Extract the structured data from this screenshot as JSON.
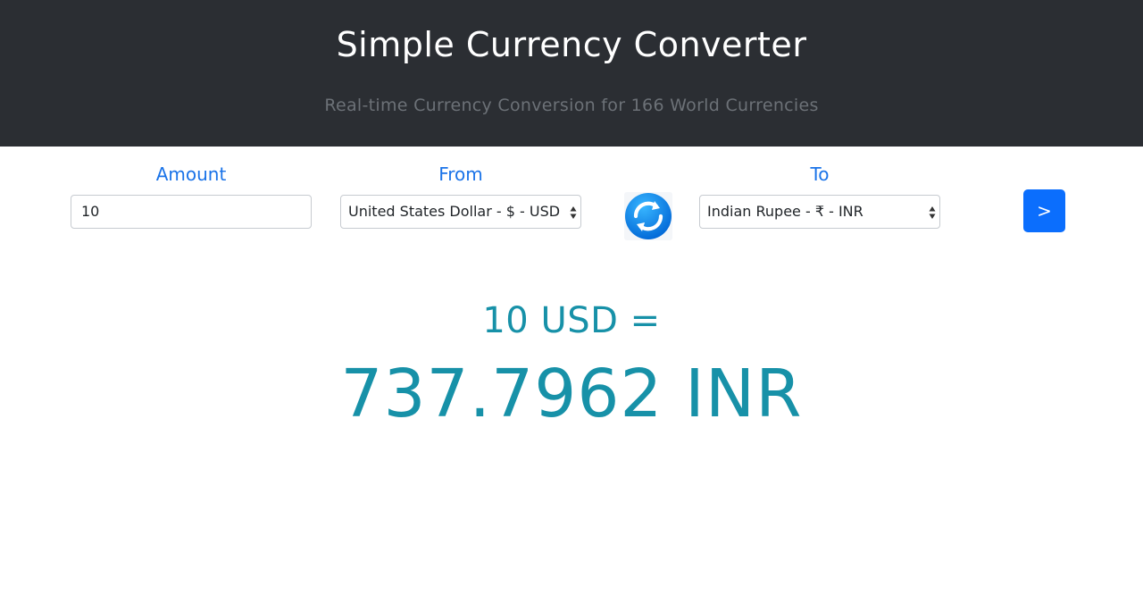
{
  "header": {
    "title": "Simple Currency Converter",
    "subtitle": "Real-time Currency Conversion for 166 World Currencies"
  },
  "form": {
    "amount_label": "Amount",
    "amount_value": "10",
    "from_label": "From",
    "from_selected": "United States Dollar - $ - USD",
    "to_label": "To",
    "to_selected": "Indian Rupee - ₹ - INR",
    "swap_icon": "refresh-icon",
    "submit_label": ">"
  },
  "result": {
    "from_text": "10 USD =",
    "to_text": "737.7962 INR"
  },
  "colors": {
    "header_bg": "#2b2e33",
    "label": "#1a73e8",
    "button": "#0b6efd",
    "result": "#1791a8"
  }
}
